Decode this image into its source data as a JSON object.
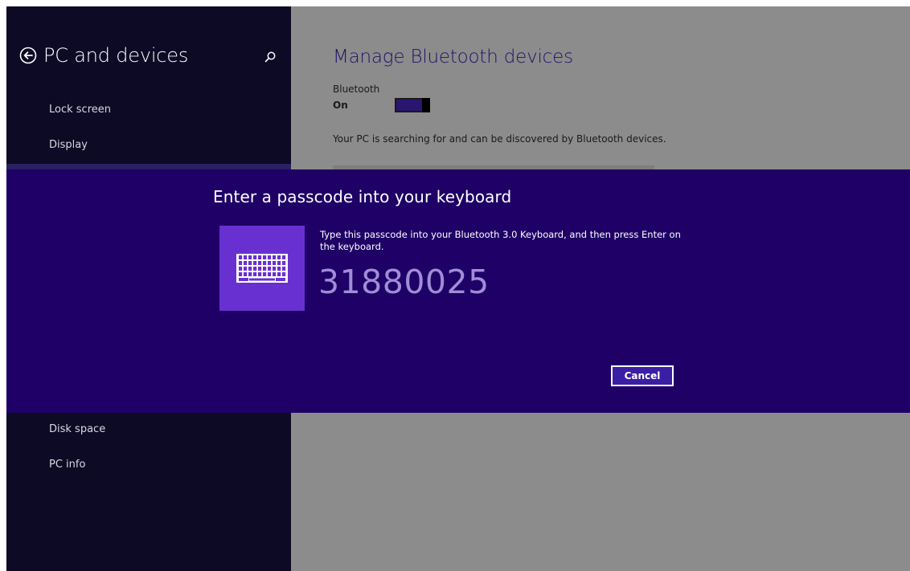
{
  "nav": {
    "title": "PC and devices",
    "items": [
      {
        "label": "Lock screen"
      },
      {
        "label": "Display"
      },
      {
        "label": "Disk space"
      },
      {
        "label": "PC info"
      }
    ]
  },
  "main": {
    "title": "Manage Bluetooth devices",
    "bluetooth_label": "Bluetooth",
    "bluetooth_state": "On",
    "bluetooth_on": true,
    "searching_text": "Your PC is searching for and can be discovered by Bluetooth devices."
  },
  "dialog": {
    "title": "Enter a passcode into your keyboard",
    "instruction": "Type this passcode into your Bluetooth 3.0 Keyboard, and then press Enter on the keyboard.",
    "passcode": "31880025",
    "cancel_label": "Cancel",
    "icon": "keyboard-icon"
  },
  "colors": {
    "nav_bg": "#0d0a26",
    "dialog_bg": "#1e0066",
    "tile_bg": "#6830d0",
    "passcode_text": "#9f8dd6",
    "dim_overlay": "#8c8c8c"
  }
}
